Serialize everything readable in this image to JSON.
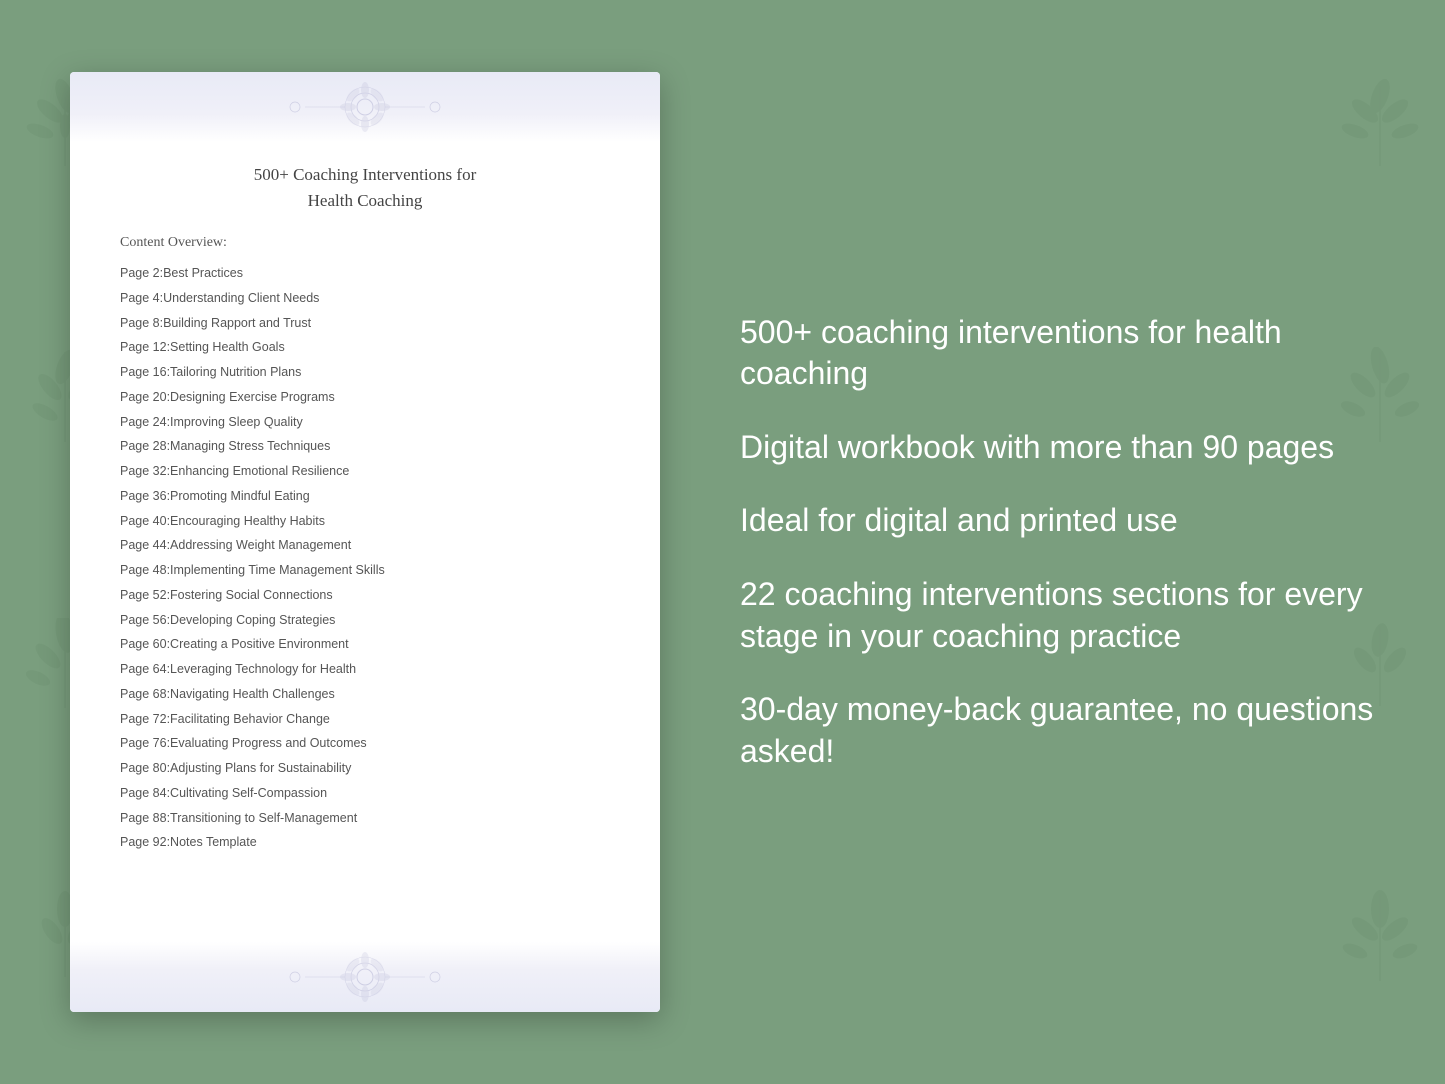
{
  "background_color": "#7a9e7e",
  "document": {
    "title_line1": "500+ Coaching Interventions for",
    "title_line2": "Health Coaching",
    "content_overview_label": "Content Overview:",
    "toc_items": [
      {
        "page": "Page  2:",
        "title": "Best Practices"
      },
      {
        "page": "Page  4:",
        "title": "Understanding Client Needs"
      },
      {
        "page": "Page  8:",
        "title": "Building Rapport and Trust"
      },
      {
        "page": "Page 12:",
        "title": "Setting Health Goals"
      },
      {
        "page": "Page 16:",
        "title": "Tailoring Nutrition Plans"
      },
      {
        "page": "Page 20:",
        "title": "Designing Exercise Programs"
      },
      {
        "page": "Page 24:",
        "title": "Improving Sleep Quality"
      },
      {
        "page": "Page 28:",
        "title": "Managing Stress Techniques"
      },
      {
        "page": "Page 32:",
        "title": "Enhancing Emotional Resilience"
      },
      {
        "page": "Page 36:",
        "title": "Promoting Mindful Eating"
      },
      {
        "page": "Page 40:",
        "title": "Encouraging Healthy Habits"
      },
      {
        "page": "Page 44:",
        "title": "Addressing Weight Management"
      },
      {
        "page": "Page 48:",
        "title": "Implementing Time Management Skills"
      },
      {
        "page": "Page 52:",
        "title": "Fostering Social Connections"
      },
      {
        "page": "Page 56:",
        "title": "Developing Coping Strategies"
      },
      {
        "page": "Page 60:",
        "title": "Creating a Positive Environment"
      },
      {
        "page": "Page 64:",
        "title": "Leveraging Technology for Health"
      },
      {
        "page": "Page 68:",
        "title": "Navigating Health Challenges"
      },
      {
        "page": "Page 72:",
        "title": "Facilitating Behavior Change"
      },
      {
        "page": "Page 76:",
        "title": "Evaluating Progress and Outcomes"
      },
      {
        "page": "Page 80:",
        "title": "Adjusting Plans for Sustainability"
      },
      {
        "page": "Page 84:",
        "title": "Cultivating Self-Compassion"
      },
      {
        "page": "Page 88:",
        "title": "Transitioning to Self-Management"
      },
      {
        "page": "Page 92:",
        "title": "Notes Template"
      }
    ]
  },
  "features": [
    "500+ coaching\ninterventions for health\ncoaching",
    "Digital workbook with\nmore than 90 pages",
    "Ideal for digital and\nprinted use",
    "22 coaching\ninterventions sections\nfor every stage in your\ncoaching practice",
    "30-day money-back\nguarantee, no\nquestions asked!"
  ]
}
